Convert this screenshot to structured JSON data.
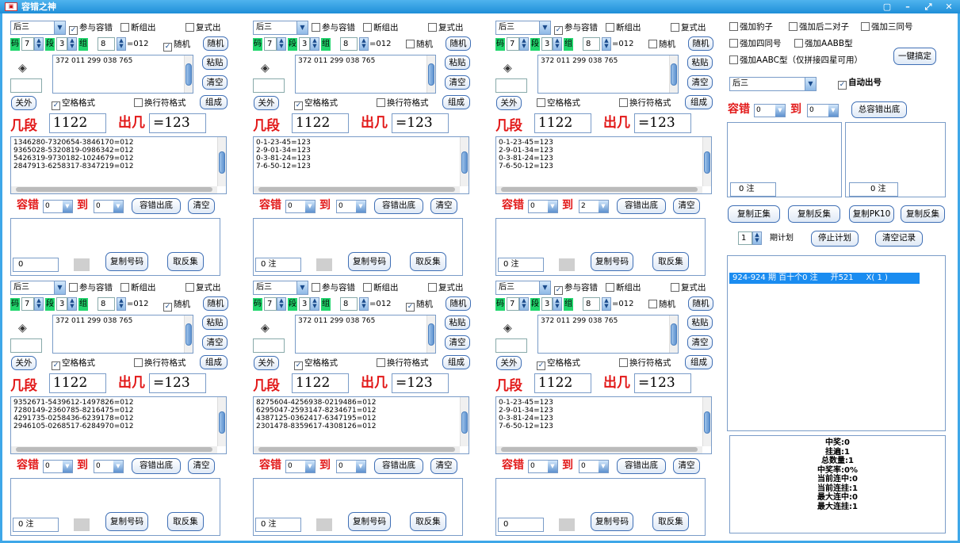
{
  "window": {
    "title": "容错之神",
    "icon": "app-logo-icon",
    "controls": [
      "minimize-icon",
      "maximize-icon",
      "close-icon"
    ]
  },
  "panels": [
    {
      "mode": "后三",
      "join": true,
      "break_out": false,
      "compound_out": false,
      "ma": "码",
      "ma_val": "7",
      "duan": "段",
      "duan_val": "3",
      "zu": "组",
      "zu_val": "8",
      "eq": "=012",
      "random": true,
      "random_label": "随机",
      "input_text": "372 011 299 038 765",
      "paste": "粘贴",
      "clear": "清空",
      "guanwai": "关外",
      "space_fmt": true,
      "space_label": "空格格式",
      "newline_fmt": false,
      "newline_label": "换行符格式",
      "zuhe": "组成",
      "jiduan_label": "几段",
      "jiduan_val": "1122",
      "chuer_label": "出几",
      "chuer_val": "=123",
      "lines": [
        "1346280-7320654-3846170=012",
        "9365028-5320819-0986342=012",
        "5426319-9730182-1024679=012",
        "2847913-6258317-8347219=012"
      ],
      "err_label": "容错",
      "err_from": "0",
      "to_label": "到",
      "err_to": "0",
      "err_btn": "容错出底",
      "clear2": "清空",
      "count": "0",
      "copy": "复制号码",
      "inverse": "取反集"
    },
    {
      "mode": "后三",
      "join": false,
      "break_out": false,
      "compound_out": false,
      "ma": "码",
      "ma_val": "7",
      "duan": "段",
      "duan_val": "3",
      "zu": "组",
      "zu_val": "8",
      "eq": "=012",
      "random": false,
      "random_label": "随机",
      "input_text": "372 011 299 038 765",
      "paste": "粘贴",
      "clear": "清空",
      "guanwai": "关外",
      "space_fmt": true,
      "space_label": "空格格式",
      "newline_fmt": false,
      "newline_label": "换行符格式",
      "zuhe": "组成",
      "jiduan_label": "几段",
      "jiduan_val": "1122",
      "chuer_label": "出几",
      "chuer_val": "=123",
      "lines": [
        "0-1-23-45=123",
        "2-9-01-34=123",
        "0-3-81-24=123",
        "7-6-50-12=123"
      ],
      "err_label": "容错",
      "err_from": "0",
      "to_label": "到",
      "err_to": "0",
      "err_btn": "容错出底",
      "clear2": "清空",
      "count": "0 注",
      "copy": "复制号码",
      "inverse": "取反集"
    },
    {
      "mode": "后三",
      "join": true,
      "break_out": false,
      "compound_out": false,
      "ma": "码",
      "ma_val": "7",
      "duan": "段",
      "duan_val": "3",
      "zu": "组",
      "zu_val": "8",
      "eq": "=012",
      "random": false,
      "random_label": "随机",
      "input_text": "372 011 299 038 765",
      "paste": "粘贴",
      "clear": "清空",
      "guanwai": "关外",
      "space_fmt": false,
      "space_label": "空格格式",
      "newline_fmt": false,
      "newline_label": "换行符格式",
      "zuhe": "组成",
      "jiduan_label": "几段",
      "jiduan_val": "1122",
      "chuer_label": "出几",
      "chuer_val": "=123",
      "lines": [
        "0-1-23-45=123",
        "2-9-01-34=123",
        "0-3-81-24=123",
        "7-6-50-12=123"
      ],
      "err_label": "容错",
      "err_from": "0",
      "to_label": "到",
      "err_to": "2",
      "err_btn": "容错出底",
      "clear2": "清空",
      "count": "0 注",
      "copy": "复制号码",
      "inverse": "取反集"
    },
    {
      "mode": "后三",
      "join": false,
      "break_out": false,
      "compound_out": false,
      "ma": "码",
      "ma_val": "7",
      "duan": "段",
      "duan_val": "3",
      "zu": "组",
      "zu_val": "8",
      "eq": "=012",
      "random": true,
      "random_label": "随机",
      "input_text": "372 011 299 038 765",
      "paste": "粘贴",
      "clear": "清空",
      "guanwai": "关外",
      "space_fmt": true,
      "space_label": "空格格式",
      "newline_fmt": false,
      "newline_label": "换行符格式",
      "zuhe": "组成",
      "jiduan_label": "几段",
      "jiduan_val": "1122",
      "chuer_label": "出几",
      "chuer_val": "=123",
      "lines": [
        "9352671-5439612-1497826=012",
        "7280149-2360785-8216475=012",
        "4291735-0258436-6239178=012",
        "2946105-0268517-6284970=012"
      ],
      "err_label": "容错",
      "err_from": "0",
      "to_label": "到",
      "err_to": "0",
      "err_btn": "容错出底",
      "clear2": "清空",
      "count": "0 注",
      "copy": "复制号码",
      "inverse": "取反集"
    },
    {
      "mode": "后三",
      "join": false,
      "break_out": false,
      "compound_out": false,
      "ma": "码",
      "ma_val": "7",
      "duan": "段",
      "duan_val": "3",
      "zu": "组",
      "zu_val": "8",
      "eq": "=012",
      "random": true,
      "random_label": "随机",
      "input_text": "372 011 299 038 765",
      "paste": "粘贴",
      "clear": "清空",
      "guanwai": "关外",
      "space_fmt": true,
      "space_label": "空格格式",
      "newline_fmt": false,
      "newline_label": "换行符格式",
      "zuhe": "组成",
      "jiduan_label": "几段",
      "jiduan_val": "1122",
      "chuer_label": "出几",
      "chuer_val": "=123",
      "lines": [
        "8275604-4256938-0219486=012",
        "6295047-2593147-8234671=012",
        "4387125-0362417-6347195=012",
        "2301478-8359617-4308126=012"
      ],
      "err_label": "容错",
      "err_from": "0",
      "to_label": "到",
      "err_to": "0",
      "err_btn": "容错出底",
      "clear2": "清空",
      "count": "0 注",
      "copy": "复制号码",
      "inverse": "取反集"
    },
    {
      "mode": "后三",
      "join": true,
      "break_out": false,
      "compound_out": false,
      "ma": "码",
      "ma_val": "7",
      "duan": "段",
      "duan_val": "3",
      "zu": "组",
      "zu_val": "8",
      "eq": "=012",
      "random": false,
      "random_label": "随机",
      "input_text": "372 011 299 038 765",
      "paste": "粘贴",
      "clear": "清空",
      "guanwai": "关外",
      "space_fmt": true,
      "space_label": "空格格式",
      "newline_fmt": false,
      "newline_label": "换行符格式",
      "zuhe": "组成",
      "jiduan_label": "几段",
      "jiduan_val": "1122",
      "chuer_label": "出几",
      "chuer_val": "=123",
      "lines": [
        "0-1-23-45=123",
        "2-9-01-34=123",
        "0-3-81-24=123",
        "7-6-50-12=123"
      ],
      "err_label": "容错",
      "err_from": "0",
      "to_label": "到",
      "err_to": "0",
      "err_btn": "容错出底",
      "clear2": "清空",
      "count": "0",
      "copy": "复制号码",
      "inverse": "取反集"
    }
  ],
  "labels": {
    "join": "参与容错",
    "break_out": "断组出",
    "compound_out": "复式出"
  },
  "right": {
    "opt1": "强加豹子",
    "opt2": "强加后二对子",
    "opt3": "强加三同号",
    "opt4": "强加四同号",
    "opt5": "强加AABB型",
    "opt6": "强加AABC型（仅拼接四星可用）",
    "one_key": "一键搞定",
    "mode": "后三",
    "auto_label": "自动出号",
    "err_label": "容错",
    "err_from": "0",
    "to_label": "到",
    "err_to": "0",
    "total_btn": "总容错出底",
    "count_left": "0 注",
    "count_right": "0 注",
    "copy_pos": "复制正集",
    "copy_neg": "复制反集",
    "copy_pk10": "复制PK10",
    "copy_neg2": "复制反集",
    "period_val": "1",
    "period_label": "期计划",
    "stop_plan": "停止计划",
    "clear_record": "清空记录",
    "log_line": "924-924 期 百十个0 注     开521     X( 1 )",
    "stats": [
      "中奖:0",
      "挂遍:1",
      "总数量:1",
      "中奖率:0%",
      "当前连中:0",
      "当前连挂:1",
      "最大连中:0",
      "最大连挂:1"
    ]
  }
}
